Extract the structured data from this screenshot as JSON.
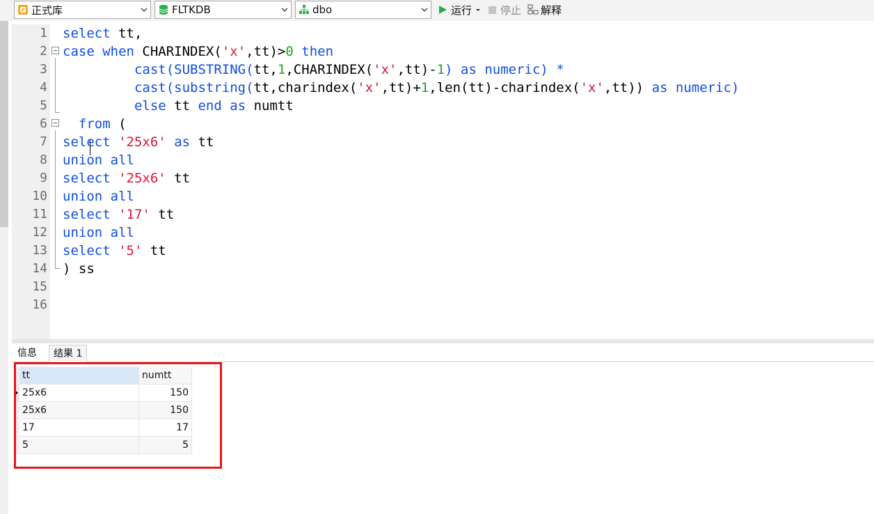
{
  "toolbar": {
    "connection": "正式库",
    "database": "FLTKDB",
    "schema": "dbo",
    "run_label": "运行",
    "stop_label": "停止",
    "explain_label": "解释"
  },
  "editor": {
    "lines": [
      {
        "n": "1",
        "tokens": [
          {
            "t": "select",
            "c": "kw"
          },
          {
            "t": " tt,",
            "c": ""
          }
        ]
      },
      {
        "n": "2",
        "tokens": [
          {
            "t": "case",
            "c": "kw"
          },
          {
            "t": " ",
            "c": ""
          },
          {
            "t": "when",
            "c": "kw"
          },
          {
            "t": " CHARINDEX(",
            "c": ""
          },
          {
            "t": "'x'",
            "c": "str"
          },
          {
            "t": ",tt)>",
            "c": ""
          },
          {
            "t": "0",
            "c": "num"
          },
          {
            "t": " ",
            "c": ""
          },
          {
            "t": "then",
            "c": "kw"
          }
        ]
      },
      {
        "n": "3",
        "tokens": [
          {
            "t": "         ",
            "c": ""
          },
          {
            "t": "cast(SUBSTRING(",
            "c": "kw"
          },
          {
            "t": "tt,",
            "c": ""
          },
          {
            "t": "1",
            "c": "num"
          },
          {
            "t": ",CHARINDEX(",
            "c": ""
          },
          {
            "t": "'x'",
            "c": "str"
          },
          {
            "t": ",tt)-",
            "c": ""
          },
          {
            "t": "1",
            "c": "num"
          },
          {
            "t": ") ",
            "c": "kw"
          },
          {
            "t": "as numeric) *",
            "c": "kw"
          }
        ]
      },
      {
        "n": "4",
        "tokens": [
          {
            "t": "         ",
            "c": ""
          },
          {
            "t": "cast(substring(",
            "c": "kw"
          },
          {
            "t": "tt,charindex(",
            "c": ""
          },
          {
            "t": "'x'",
            "c": "str"
          },
          {
            "t": ",tt)+",
            "c": ""
          },
          {
            "t": "1",
            "c": "num"
          },
          {
            "t": ",len(tt)-charindex(",
            "c": ""
          },
          {
            "t": "'x'",
            "c": "str"
          },
          {
            "t": ",tt)) ",
            "c": ""
          },
          {
            "t": "as numeric)",
            "c": "kw"
          }
        ]
      },
      {
        "n": "5",
        "tokens": [
          {
            "t": "         ",
            "c": ""
          },
          {
            "t": "else",
            "c": "kw"
          },
          {
            "t": " tt ",
            "c": ""
          },
          {
            "t": "end",
            "c": "kw"
          },
          {
            "t": " ",
            "c": ""
          },
          {
            "t": "as",
            "c": "kw"
          },
          {
            "t": " numtt",
            "c": ""
          }
        ]
      },
      {
        "n": "6",
        "tokens": [
          {
            "t": "  ",
            "c": ""
          },
          {
            "t": "from",
            "c": "kw"
          },
          {
            "t": " (",
            "c": ""
          }
        ]
      },
      {
        "n": "7",
        "tokens": [
          {
            "t": "select",
            "c": "kw"
          },
          {
            "t": " ",
            "c": ""
          },
          {
            "t": "'25x6'",
            "c": "str"
          },
          {
            "t": " ",
            "c": ""
          },
          {
            "t": "as",
            "c": "kw"
          },
          {
            "t": " tt",
            "c": ""
          }
        ]
      },
      {
        "n": "8",
        "tokens": [
          {
            "t": "union all",
            "c": "kw"
          }
        ]
      },
      {
        "n": "9",
        "tokens": [
          {
            "t": "select",
            "c": "kw"
          },
          {
            "t": " ",
            "c": ""
          },
          {
            "t": "'25x6'",
            "c": "str"
          },
          {
            "t": " tt",
            "c": ""
          }
        ]
      },
      {
        "n": "10",
        "tokens": [
          {
            "t": "union all",
            "c": "kw"
          }
        ]
      },
      {
        "n": "11",
        "tokens": [
          {
            "t": "select",
            "c": "kw"
          },
          {
            "t": " ",
            "c": ""
          },
          {
            "t": "'17'",
            "c": "str"
          },
          {
            "t": " tt",
            "c": ""
          }
        ]
      },
      {
        "n": "12",
        "tokens": [
          {
            "t": "union all",
            "c": "kw"
          }
        ]
      },
      {
        "n": "13",
        "tokens": [
          {
            "t": "select",
            "c": "kw"
          },
          {
            "t": " ",
            "c": ""
          },
          {
            "t": "'5'",
            "c": "str"
          },
          {
            "t": " tt",
            "c": ""
          }
        ]
      },
      {
        "n": "14",
        "tokens": [
          {
            "t": ") ss",
            "c": ""
          }
        ]
      },
      {
        "n": "15",
        "tokens": []
      },
      {
        "n": "16",
        "tokens": []
      }
    ]
  },
  "results": {
    "tabs": [
      "信息",
      "结果 1"
    ],
    "columns": [
      "tt",
      "numtt"
    ],
    "rows": [
      [
        "25x6",
        "150"
      ],
      [
        "25x6",
        "150"
      ],
      [
        "17",
        "17"
      ],
      [
        "5",
        "5"
      ]
    ]
  },
  "colors": {
    "keyword": "#0f4ee0",
    "string": "#d3163a",
    "number": "#1fa51f",
    "highlight_box": "#e8141a",
    "run_icon": "#22b14c"
  },
  "icons": [
    "database-connection-icon",
    "database-icon",
    "schema-icon",
    "run-icon",
    "stop-icon",
    "explain-icon",
    "chevron-down-icon",
    "fold-icon"
  ]
}
